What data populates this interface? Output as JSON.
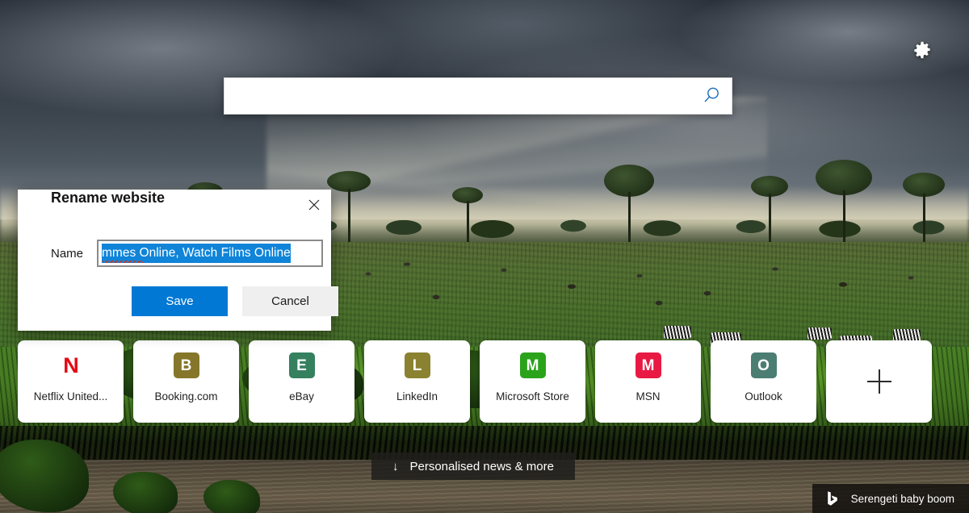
{
  "background": {
    "scene_name": "Serengeti savanna under storm clouds",
    "sky_color": "#333a43",
    "grass_color": "#3f7320",
    "river_color": "#5c5240"
  },
  "top": {
    "settings_icon": "gear-icon",
    "search": {
      "value": "",
      "placeholder": "",
      "icon": "search-icon",
      "icon_color": "#1a6bb5"
    }
  },
  "dialog": {
    "title": "Rename website",
    "close_icon": "close-icon",
    "name_label": "Name",
    "name_value": "mmes Online, Watch Films Online",
    "name_selected": true,
    "spellcheck_word": "mmes",
    "save_label": "Save",
    "cancel_label": "Cancel",
    "save_color": "#0078d4",
    "cancel_color": "#efefef"
  },
  "tiles": [
    {
      "label": "Netflix United...",
      "icon": "netflix-icon",
      "glyph": "N",
      "bg": "transparent",
      "fg": "#e50914",
      "style": "netflix"
    },
    {
      "label": "Booking.com",
      "icon": "booking-icon",
      "glyph": "B",
      "bg": "#857629",
      "fg": "#ffffff",
      "style": "square"
    },
    {
      "label": "eBay",
      "icon": "ebay-icon",
      "glyph": "E",
      "bg": "#35805f",
      "fg": "#ffffff",
      "style": "square"
    },
    {
      "label": "LinkedIn",
      "icon": "linkedin-icon",
      "glyph": "L",
      "bg": "#8b8231",
      "fg": "#ffffff",
      "style": "square"
    },
    {
      "label": "Microsoft Store",
      "icon": "microsoft-store-icon",
      "glyph": "M",
      "bg": "#2aa31b",
      "fg": "#ffffff",
      "style": "square"
    },
    {
      "label": "MSN",
      "icon": "msn-icon",
      "glyph": "M",
      "bg": "#e81a43",
      "fg": "#ffffff",
      "style": "square"
    },
    {
      "label": "Outlook",
      "icon": "outlook-icon",
      "glyph": "O",
      "bg": "#4c7d72",
      "fg": "#ffffff",
      "style": "square"
    },
    {
      "label": "",
      "icon": "add-icon",
      "glyph": "+",
      "bg": "transparent",
      "fg": "#2b2b2b",
      "style": "add"
    }
  ],
  "news_bar": {
    "arrow_icon": "arrow-down-icon",
    "label": "Personalised news & more"
  },
  "attribution": {
    "logo_icon": "bing-logo-icon",
    "label": "Serengeti baby boom"
  }
}
